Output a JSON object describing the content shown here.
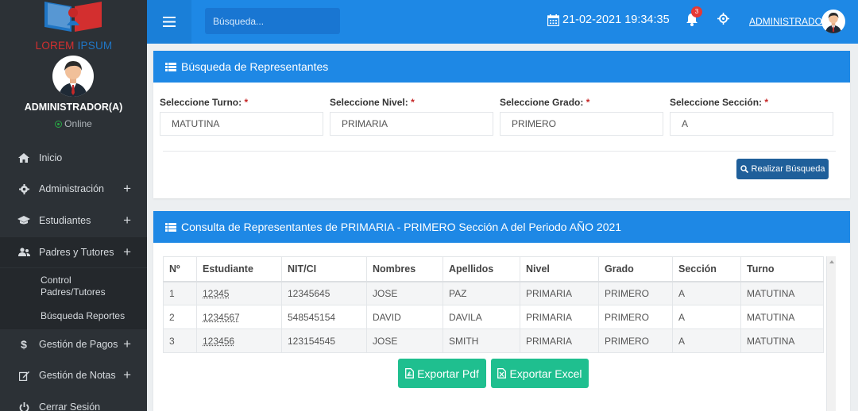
{
  "sidebar": {
    "brand_part1": "LOREM",
    "brand_part2": "IPSUM",
    "user_name": "ADMINISTRADOR(A)",
    "user_status": "Online",
    "menu": [
      {
        "label": "Inicio",
        "icon": "home-icon"
      },
      {
        "label": "Administración",
        "icon": "gear-icon",
        "expandable": "+"
      },
      {
        "label": "Estudiantes",
        "icon": "graduation-cap-icon",
        "expandable": "+"
      },
      {
        "label": "Padres y Tutores",
        "icon": "users-icon",
        "expandable": "+"
      },
      {
        "label": "Gestión de Pagos",
        "icon": "dollar-icon",
        "expandable": "+"
      },
      {
        "label": "Gestión de Notas",
        "icon": "edit-icon",
        "expandable": "+"
      },
      {
        "label": "Cerrar Sesión",
        "icon": "power-icon"
      }
    ],
    "submenu": [
      {
        "label": "Control Padres/Tutores"
      },
      {
        "label": "Búsqueda Reportes"
      }
    ]
  },
  "topbar": {
    "search_placeholder": "Búsqueda...",
    "datetime": "21-02-2021 19:34:35",
    "notification_count": "3",
    "user_link": "ADMINISTRADOR"
  },
  "search_panel": {
    "title": "Búsqueda de Representantes",
    "fields": [
      {
        "label": "Seleccione Turno:",
        "required": "*",
        "value": "MATUTINA"
      },
      {
        "label": "Seleccione Nivel:",
        "required": "*",
        "value": "PRIMARIA"
      },
      {
        "label": "Seleccione Grado:",
        "required": "*",
        "value": "PRIMERO"
      },
      {
        "label": "Seleccione Sección:",
        "required": "*",
        "value": "A"
      }
    ],
    "button": "Realizar Búsqueda"
  },
  "results_panel": {
    "title": "Consulta de Representantes de PRIMARIA - PRIMERO Sección A del Periodo AÑO 2021",
    "columns": [
      "Nº",
      "Estudiante",
      "NIT/CI",
      "Nombres",
      "Apellidos",
      "Nivel",
      "Grado",
      "Sección",
      "Turno"
    ],
    "rows": [
      [
        "1",
        "12345",
        "12345645",
        "JOSE",
        "PAZ",
        "PRIMARIA",
        "PRIMERO",
        "A",
        "MATUTINA"
      ],
      [
        "2",
        "1234567",
        "548545154",
        "DAVID",
        "DAVILA",
        "PRIMARIA",
        "PRIMERO",
        "A",
        "MATUTINA"
      ],
      [
        "3",
        "123456",
        "123154545",
        "JOSE",
        "SMITH",
        "PRIMARIA",
        "PRIMERO",
        "A",
        "MATUTINA"
      ]
    ],
    "export_pdf": "Exportar Pdf",
    "export_excel": "Exportar Excel"
  },
  "colors": {
    "primary": "#1e88e5",
    "sidebar": "#2c3136",
    "export": "#1fbf8f",
    "search_button": "#1f5f9a"
  }
}
